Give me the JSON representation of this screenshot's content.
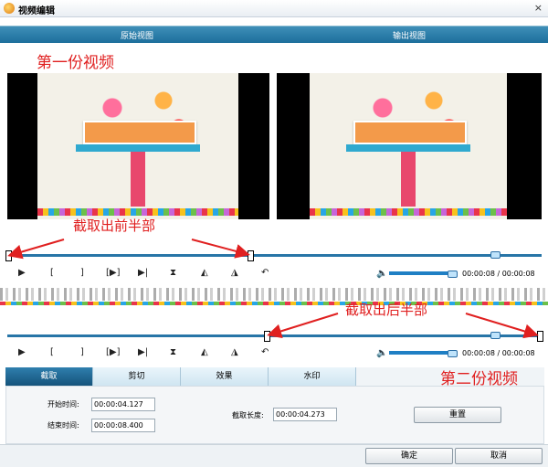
{
  "window": {
    "title": "视频编辑",
    "close_label": "×"
  },
  "header": {
    "original_view": "原始视图",
    "output_view": "输出视图"
  },
  "annotations": {
    "first_video": "第一份视频",
    "cut_front_half": "截取出前半部",
    "cut_back_half": "截取出后半部",
    "second_video": "第二份视频"
  },
  "player_top": {
    "time_display": "00:00:08 / 00:00:08",
    "volume_fraction": 0.85,
    "progress_fraction": 0.5
  },
  "player_bottom": {
    "time_display": "00:00:08 / 00:00:08",
    "volume_fraction": 0.85,
    "progress_fraction": 1.0
  },
  "controls": {
    "play": "▶",
    "mark_in": "[",
    "mark_out": "]",
    "play_selection": "[▶]",
    "goto_end": "▶|",
    "split": "⧗",
    "prev_key": "◭",
    "next_key": "◮",
    "undo": "↶"
  },
  "tabs": [
    {
      "label": "截取",
      "active": true
    },
    {
      "label": "剪切",
      "active": false
    },
    {
      "label": "效果",
      "active": false
    },
    {
      "label": "水印",
      "active": false
    }
  ],
  "trim": {
    "start_label": "开始时间:",
    "start_value": "00:00:04.127",
    "end_label": "结束时间:",
    "end_value": "00:00:08.400",
    "length_label": "截取长度:",
    "length_value": "00:00:04.273",
    "reset_label": "重置"
  },
  "footer": {
    "ok_label": "确定",
    "cancel_label": "取消"
  },
  "icons": [
    "app-icon",
    "close-icon",
    "play-icon",
    "mark-in-icon",
    "mark-out-icon",
    "play-selection-icon",
    "goto-end-icon",
    "split-icon",
    "prev-key-icon",
    "next-key-icon",
    "undo-icon",
    "speaker-icon"
  ]
}
